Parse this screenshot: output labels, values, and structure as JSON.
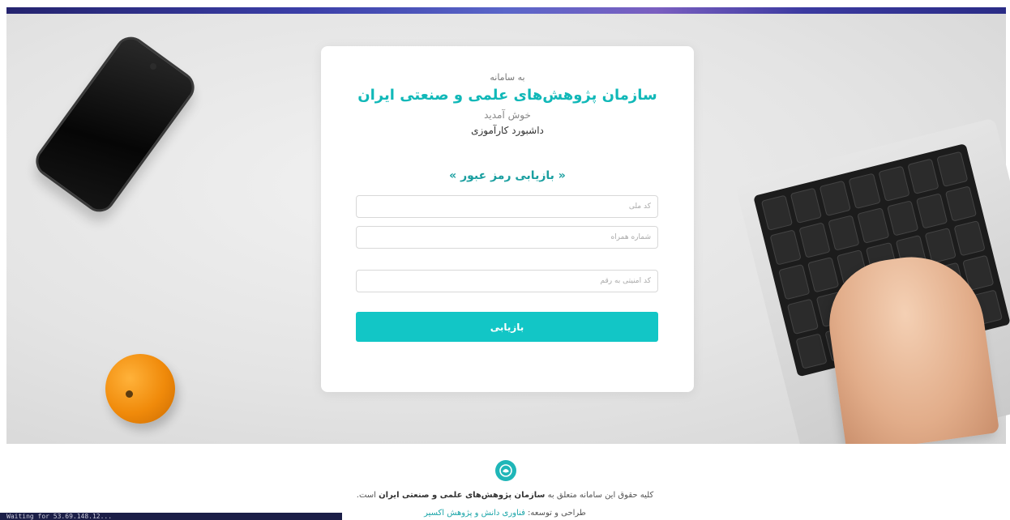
{
  "card": {
    "intro": "به سامانه",
    "org_name": "سازمان پژوهش‌های علمی و صنعتی ایران",
    "welcome": "خوش آمدید",
    "dashboard": "داشبورد کارآموزی",
    "form_title": "« بازیابی رمز عبور »",
    "fields": {
      "national_code_placeholder": "کد ملی",
      "mobile_placeholder": "شماره همراه",
      "captcha_placeholder": "کد امنیتی به رقم"
    },
    "submit_label": "بازیابی"
  },
  "footer": {
    "copyright_prefix": "کلیه حقوق این سامانه متعلق به ",
    "copyright_org": "سازمان پژوهش‌های علمی و صنعتی ایران",
    "copyright_suffix": " است.",
    "credits_prefix": "طراحی و توسعه: ",
    "credits_link": "فناوری دانش و پژوهش اکسیر"
  },
  "status_bar": {
    "text": "Waiting for 53.69.148.12..."
  },
  "colors": {
    "accent": "#12c6c6",
    "title": "#11b8b8",
    "status_bg": "#1b1e47"
  },
  "icons": {
    "logo": "org-logo-icon"
  }
}
